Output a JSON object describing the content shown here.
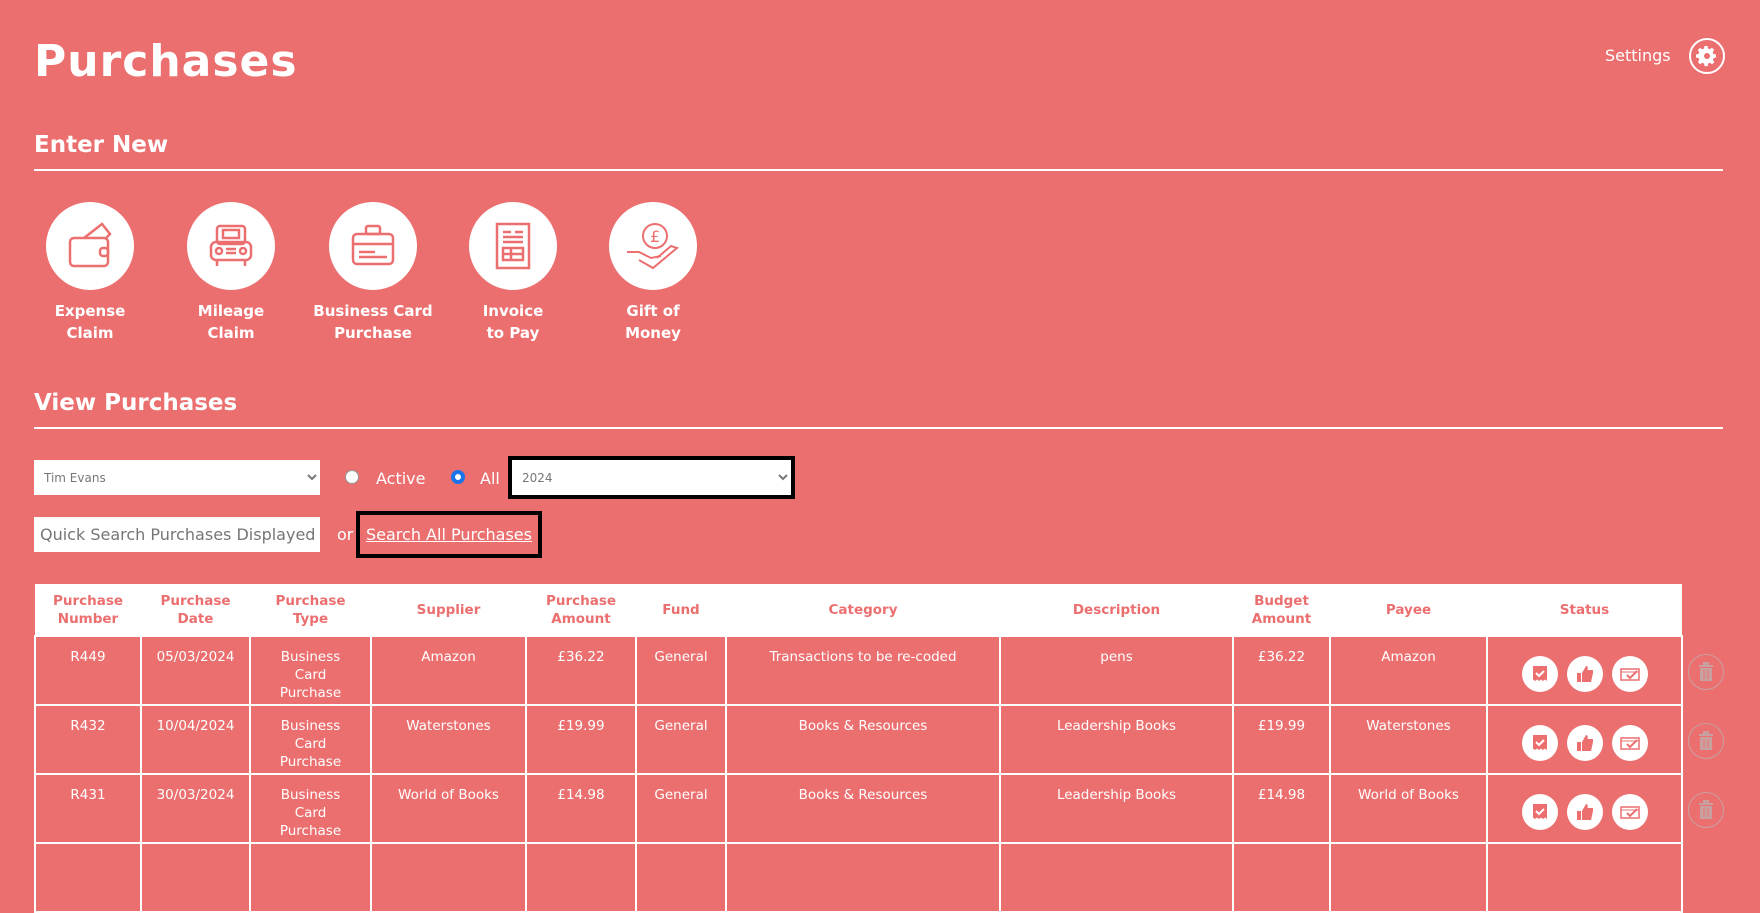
{
  "header": {
    "title": "Purchases",
    "settings_label": "Settings"
  },
  "enter_new": {
    "heading": "Enter New",
    "tiles": [
      {
        "line1": "Expense",
        "line2": "Claim",
        "icon": "wallet-icon"
      },
      {
        "line1": "Mileage",
        "line2": "Claim",
        "icon": "car-icon"
      },
      {
        "line1": "Business Card",
        "line2": "Purchase",
        "icon": "briefcase-card-icon"
      },
      {
        "line1": "Invoice",
        "line2": "to Pay",
        "icon": "invoice-icon"
      },
      {
        "line1": "Gift of",
        "line2": "Money",
        "icon": "pound-hand-icon"
      }
    ]
  },
  "view": {
    "heading": "View Purchases",
    "user_select": "Tim Evans",
    "radio_active": "Active",
    "radio_all": "All",
    "year_select": "2024",
    "search_placeholder": "Quick Search Purchases Displayed",
    "or": "or",
    "search_all": "Search All Purchases"
  },
  "table": {
    "headers": [
      [
        "Purchase",
        "Number"
      ],
      [
        "Purchase",
        "Date"
      ],
      [
        "Purchase",
        "Type"
      ],
      [
        "Supplier",
        ""
      ],
      [
        "Purchase",
        "Amount"
      ],
      [
        "Fund",
        ""
      ],
      [
        "Category",
        ""
      ],
      [
        "Description",
        ""
      ],
      [
        "Budget",
        "Amount"
      ],
      [
        "Payee",
        ""
      ],
      [
        "Status",
        ""
      ]
    ],
    "rows": [
      {
        "number": "R449",
        "date": "05/03/2024",
        "type": [
          "Business",
          "Card",
          "Purchase"
        ],
        "supplier": "Amazon",
        "amount": "£36.22",
        "fund": "General",
        "category": "Transactions to be re-coded",
        "description": "pens",
        "budget": "£36.22",
        "payee": "Amazon"
      },
      {
        "number": "R432",
        "date": "10/04/2024",
        "type": [
          "Business",
          "Card",
          "Purchase"
        ],
        "supplier": "Waterstones",
        "amount": "£19.99",
        "fund": "General",
        "category": "Books & Resources",
        "description": "Leadership Books",
        "budget": "£19.99",
        "payee": "Waterstones"
      },
      {
        "number": "R431",
        "date": "30/03/2024",
        "type": [
          "Business",
          "Card",
          "Purchase"
        ],
        "supplier": "World of Books",
        "amount": "£14.98",
        "fund": "General",
        "category": "Books & Resources",
        "description": "Leadership Books",
        "budget": "£14.98",
        "payee": "World of Books"
      }
    ]
  },
  "colors": {
    "background": "#ec6f70",
    "accent": "#ffffff"
  }
}
